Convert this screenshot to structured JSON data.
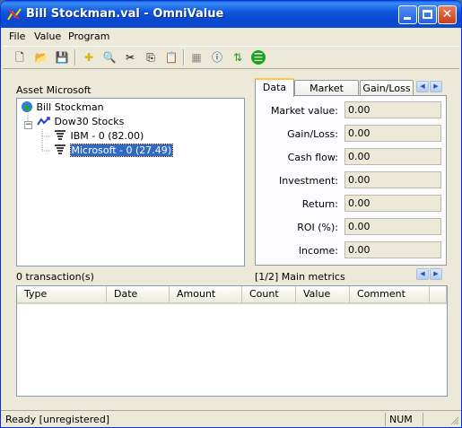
{
  "window": {
    "title": "Bill Stockman.val - OmniValue"
  },
  "menu": {
    "items": [
      "File",
      "Value",
      "Program"
    ]
  },
  "toolbar": {
    "buttons": [
      {
        "name": "new-icon",
        "glyph": "🗋"
      },
      {
        "name": "open-icon",
        "glyph": "📂"
      },
      {
        "name": "save-icon",
        "glyph": "💾"
      },
      {
        "name": "add-icon",
        "glyph": "✚"
      },
      {
        "name": "find-icon",
        "glyph": "🔍"
      },
      {
        "name": "cut-icon",
        "glyph": "✂"
      },
      {
        "name": "copy-icon",
        "glyph": "⎘"
      },
      {
        "name": "paste-icon",
        "glyph": "📋"
      },
      {
        "name": "properties-icon",
        "glyph": "▦"
      },
      {
        "name": "info-icon",
        "glyph": "ⓘ"
      },
      {
        "name": "refresh-icon",
        "glyph": "⇅"
      },
      {
        "name": "list-icon",
        "glyph": "☰"
      }
    ]
  },
  "asset": {
    "label": "Asset Microsoft",
    "tree": [
      {
        "text": "Bill Stockman",
        "icon": "globe-icon"
      },
      {
        "text": "Dow30 Stocks",
        "icon": "chart-icon"
      },
      {
        "text": "IBM - 0 (82.00)",
        "icon": "stock-icon"
      },
      {
        "text": "Microsoft - 0 (27.49)",
        "icon": "stock-icon",
        "selected": true
      }
    ]
  },
  "tabs": [
    "Data",
    "Market value",
    "Gain/Loss"
  ],
  "metrics": [
    {
      "label": "Market value:",
      "value": "0.00"
    },
    {
      "label": "Gain/Loss:",
      "value": "0.00"
    },
    {
      "label": "Cash flow:",
      "value": "0.00"
    },
    {
      "label": "Investment:",
      "value": "0.00"
    },
    {
      "label": "Return:",
      "value": "0.00"
    },
    {
      "label": "ROI (%):",
      "value": "0.00"
    },
    {
      "label": "Income:",
      "value": "0.00"
    }
  ],
  "transactions": {
    "count_label": "0 transaction(s)",
    "metrics_label": "[1/2] Main metrics",
    "columns": [
      "Type",
      "Date",
      "Amount",
      "Count",
      "Value",
      "Comment"
    ]
  },
  "status": {
    "text": "Ready [unregistered]",
    "num": "NUM"
  },
  "colors": {
    "titlebar": "#0a49d0",
    "selection": "#316ac5",
    "accent_tab": "#ffc83c"
  }
}
